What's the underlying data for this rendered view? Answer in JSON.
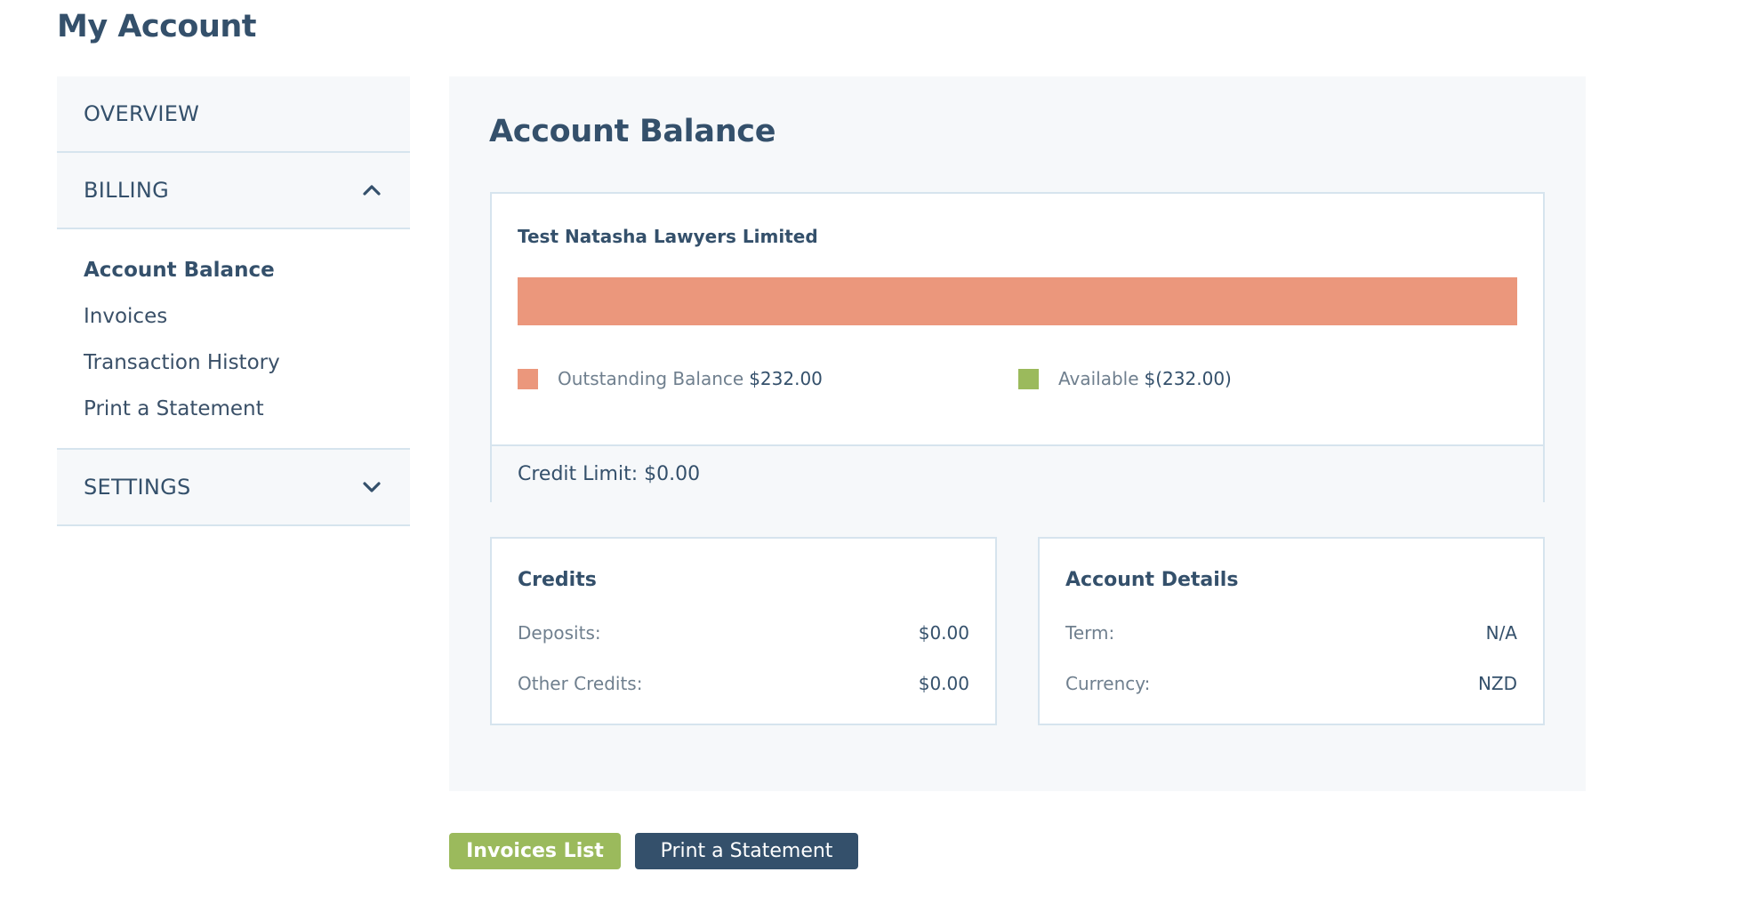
{
  "page": {
    "title": "My Account"
  },
  "sidebar": {
    "overview_label": "OVERVIEW",
    "billing_label": "BILLING",
    "billing_items": [
      {
        "label": "Account Balance",
        "active": true
      },
      {
        "label": "Invoices",
        "active": false
      },
      {
        "label": "Transaction History",
        "active": false
      },
      {
        "label": "Print a Statement",
        "active": false
      }
    ],
    "settings_label": "SETTINGS"
  },
  "main": {
    "title": "Account Balance",
    "balance": {
      "company": "Test Natasha Lawyers Limited",
      "outstanding_fraction": 1.0,
      "outstanding_label": "Outstanding Balance",
      "outstanding_value": "$232.00",
      "available_label": "Available",
      "available_value": "$(232.00)",
      "credit_limit": "Credit Limit: $0.00"
    },
    "credits": {
      "title": "Credits",
      "rows": [
        {
          "label": "Deposits:",
          "value": "$0.00"
        },
        {
          "label": "Other Credits:",
          "value": "$0.00"
        }
      ]
    },
    "account_details": {
      "title": "Account Details",
      "rows": [
        {
          "label": "Term:",
          "value": "N/A"
        },
        {
          "label": "Currency:",
          "value": "NZD"
        }
      ]
    }
  },
  "actions": {
    "invoices_list_label": "Invoices List",
    "print_statement_label": "Print a Statement"
  },
  "colors": {
    "outstanding": "#eb977c",
    "available": "#9bba5c",
    "navy": "#34506b"
  },
  "icons": {
    "billing_toggle": "chevron-up-icon",
    "settings_toggle": "chevron-down-icon"
  }
}
